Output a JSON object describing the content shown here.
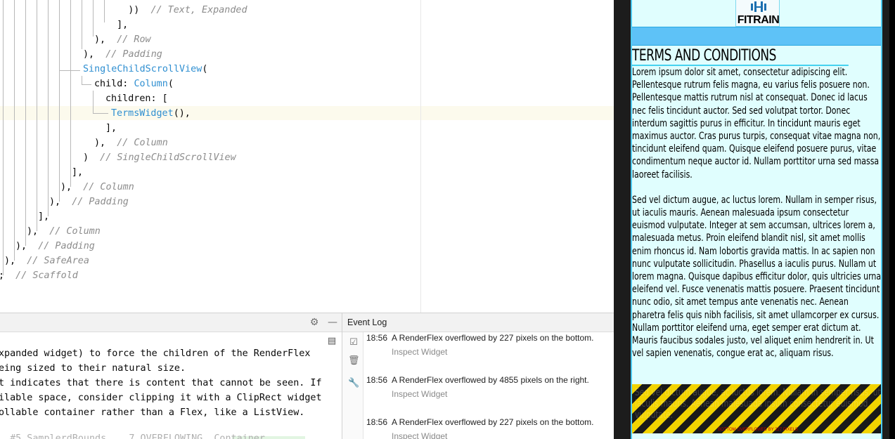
{
  "editor": {
    "code_lines": [
      {
        "code": "    ))",
        "comment": "  // Text, Expanded"
      },
      {
        "code": "  ],",
        "comment": ""
      },
      {
        "code": "),",
        "comment": "  // Row"
      },
      {
        "code": "),",
        "comment": "  // Padding"
      },
      {
        "code": "SingleChildScrollView(",
        "comment": ""
      },
      {
        "code": "child: Column(",
        "comment": ""
      },
      {
        "code": "children: [",
        "comment": ""
      },
      {
        "code": "TermsWidget(),",
        "comment": ""
      },
      {
        "code": "],",
        "comment": ""
      },
      {
        "code": "),",
        "comment": "  // Column"
      },
      {
        "code": ")",
        "comment": "  // SingleChildScrollView"
      },
      {
        "code": "],",
        "comment": ""
      },
      {
        "code": "),",
        "comment": "  // Column"
      },
      {
        "code": "),",
        "comment": "  // Padding"
      },
      {
        "code": "],",
        "comment": ""
      },
      {
        "code": "),",
        "comment": "  // Column"
      },
      {
        "code": "),",
        "comment": "  // Padding"
      },
      {
        "code": "),",
        "comment": "  // SafeArea"
      },
      {
        "code": ";",
        "comment": "  // Scaffold"
      }
    ],
    "tokens": {
      "child_label": "child: ",
      "column_class": "Column",
      "paren_open": "(",
      "scrollview_class": "SingleChildScrollView",
      "terms_class": "TermsWidget",
      "terms_suffix": "(),"
    }
  },
  "console": {
    "lines": [
      "xpanded widget) to force the children of the RenderFlex",
      "eing sized to their natural size.",
      "t indicates that there is content that cannot be seen. If",
      "ilable space, consider clipping it with a ClipRect widget",
      "ollable container rather than a Flex, like a ListView."
    ],
    "dim_line": "  #5 SamplerdBounds... 7 OVERFLOWING  Container"
  },
  "event_log": {
    "title": "Event Log",
    "entries": [
      {
        "time": "18:56",
        "message": "A RenderFlex overflowed by 227 pixels on the bottom.",
        "link": "Inspect Widget"
      },
      {
        "time": "18:56",
        "message": "A RenderFlex overflowed by 4855 pixels on the right.",
        "link": "Inspect Widget"
      },
      {
        "time": "18:56",
        "message": "A RenderFlex overflowed by 227 pixels on the bottom.",
        "link": "Inspect Widget"
      }
    ]
  },
  "app": {
    "logo_text": "FITRAIN",
    "terms_title": "TERMS AND CONDITIONS",
    "paragraphs": [
      "Lorem ipsum dolor sit amet, consectetur adipiscing elit. Pellentesque rutrum felis magna, eu varius felis posuere non. Pellentesque mattis rutrum nisl at consequat. Donec id lacus nec felis tincidunt auctor. Sed sed volutpat tortor. Donec interdum sagittis purus in efficitur. In tincidunt mauris eget maximus auctor. Cras purus turpis, consequat vitae magna non, tincidunt eleifend quam. Quisque eleifend posuere purus, vitae condimentum neque auctor id. Nullam porttitor urna sed massa laoreet facilisis.",
      "Sed vel dictum augue, ac luctus lorem. Nullam in semper risus, ut iaculis mauris. Aenean malesuada ipsum consectetur euismod vulputate. Integer at sem accumsan, ultrices lorem a, malesuada metus. Proin eleifend blandit nisl, sit amet mollis enim rhoncus id. Nam lobortis gravida mattis. In ac sapien non nunc vulputate sollicitudin. Phasellus a iaculis purus. Nullam ut lorem magna. Quisque dapibus efficitur dolor, quis ultricies urna eleifend vel. Fusce venenatis mattis posuere. Praesent tincidunt nunc odio, sit amet tempus ante venenatis nec. Aenean pharetra felis quis nibh facilisis, sit amet ullamcorper ex cursus. Nullam porttitor eleifend urna, eget semper erat dictum at. Mauris faucibus sodales justo, vel aliquet enim hendrerit in. Ut vel sapien venenatis, congue erat ac, aliquam risus."
    ],
    "overflow_ghost_text": "Sed vel dictum augue, ac luctus lorem. Nullam in semper risus, ut iaculis mauris. Aenean malesuada ipsum consectetur euismod vulputate.",
    "overflow_label": "BOTTOM OVERFLOWED BY 227 PIXELS"
  },
  "colors": {
    "accent_blue": "#2f8fd1",
    "app_background": "#e0fefe",
    "app_bar": "#5ec2f7",
    "overflow_yellow": "#f2d400",
    "overflow_text": "#c00000"
  },
  "icons": {
    "console_settings": "gear-icon",
    "console_minimize": "minimize-icon",
    "console_layout": "layout-icon",
    "log_mark_read": "check-icon",
    "log_clear": "trash-icon",
    "log_settings": "wrench-icon",
    "app_logo": "dumbbell-icon"
  }
}
